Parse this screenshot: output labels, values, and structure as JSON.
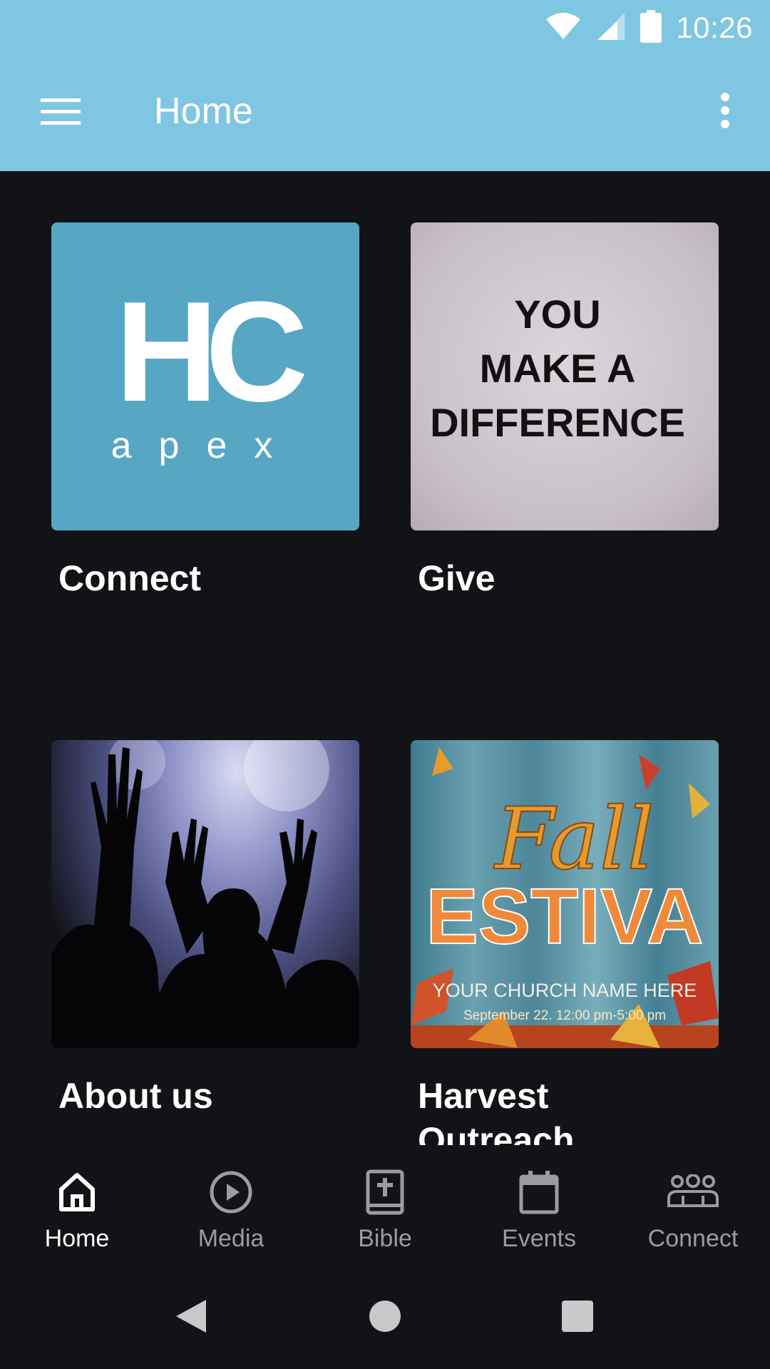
{
  "status_bar": {
    "time": "10:26"
  },
  "app_bar": {
    "title": "Home"
  },
  "tiles": [
    {
      "label": "Connect",
      "image": {
        "logo_text": "HC",
        "logo_sub": "apex"
      }
    },
    {
      "label": "Give",
      "image": {
        "line1": "YOU",
        "line2": "MAKE A",
        "line3": "DIFFERENCE"
      }
    },
    {
      "label": "About us",
      "image": {
        "description": "worship-crowd-photo"
      }
    },
    {
      "label": "Harvest Outreach",
      "image": {
        "script": "Fall",
        "big": "ESTIVA",
        "sub": "YOUR CHURCH NAME HERE",
        "date": "September 22. 12:00 pm-5:00 pm"
      }
    }
  ],
  "bottom_nav": {
    "items": [
      {
        "label": "Home",
        "icon": "home-icon",
        "active": true
      },
      {
        "label": "Media",
        "icon": "play-icon",
        "active": false
      },
      {
        "label": "Bible",
        "icon": "bible-icon",
        "active": false
      },
      {
        "label": "Events",
        "icon": "calendar-icon",
        "active": false
      },
      {
        "label": "Connect",
        "icon": "group-icon",
        "active": false
      }
    ]
  },
  "colors": {
    "accent": "#7ec6e1",
    "background": "#121316",
    "tile_connect": "#57a7c4",
    "nav_inactive": "#9a9ca1"
  }
}
